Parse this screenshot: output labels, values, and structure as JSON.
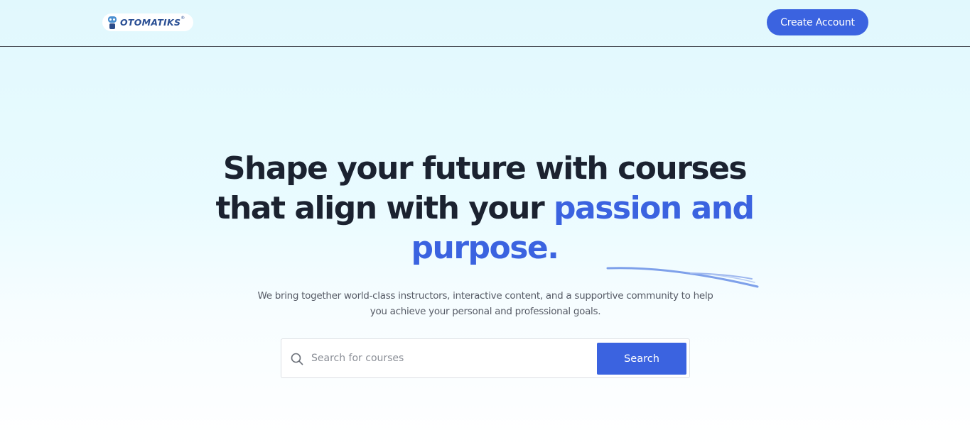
{
  "header": {
    "logo_text": "OTOMATIKS",
    "logo_mark": "®",
    "create_account_label": "Create Account"
  },
  "hero": {
    "title_part1": "Shape your future with courses that align with your ",
    "title_accent": "passion and purpose.",
    "subtitle": "We bring together world-class instructors, interactive content, and a supportive community to help you achieve your personal and professional goals."
  },
  "search": {
    "placeholder": "Search for courses",
    "value": "",
    "button_label": "Search"
  },
  "colors": {
    "accent": "#3b63e0",
    "heading": "#1b2230",
    "background_top": "#e1f8fd",
    "background_bottom": "#ffffff"
  },
  "icons": {
    "logo": "robot-mascot-logo",
    "search": "search-icon",
    "underline": "scribble-underline"
  }
}
